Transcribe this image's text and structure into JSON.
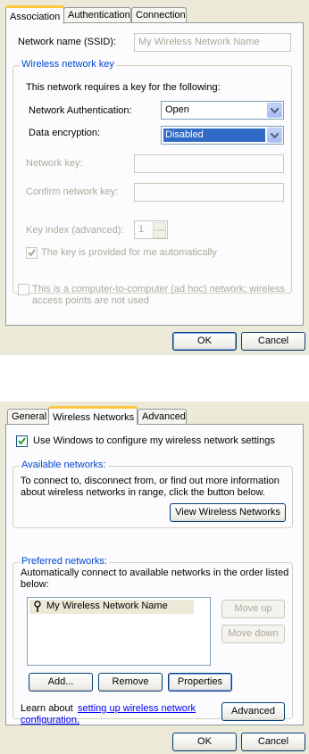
{
  "dialog1": {
    "tabs": [
      "Association",
      "Authentication",
      "Connection"
    ],
    "ssid_label": "Network name (SSID):",
    "ssid_placeholder": "My Wireless Network Name",
    "group_title": "Wireless network key",
    "requires_key_text": "This network requires a key for the following:",
    "auth_label": "Network Authentication:",
    "auth_value": "Open",
    "encryption_label": "Data encryption:",
    "encryption_value": "Disabled",
    "network_key_label": "Network key:",
    "confirm_key_label": "Confirm network key:",
    "key_index_label": "Key index (advanced):",
    "key_index_value": "1",
    "auto_key_label": "The key is provided for me automatically",
    "adhoc_line1": "This is a computer-to-computer (ad hoc) network; wireless",
    "adhoc_line2": "access points are not used",
    "ok": "OK",
    "cancel": "Cancel"
  },
  "dialog2": {
    "tabs": [
      "General",
      "Wireless Networks",
      "Advanced"
    ],
    "use_windows_label": "Use Windows to configure my wireless network settings",
    "available_title": "Available networks:",
    "available_line1": "To connect to, disconnect from, or find out more information",
    "available_line2": "about wireless networks in range, click the button below.",
    "view_button": "View Wireless Networks",
    "preferred_title": "Preferred networks:",
    "preferred_line1": "Automatically connect to available networks in the order listed",
    "preferred_line2": "below:",
    "networks": [
      "My Wireless Network Name"
    ],
    "move_up": "Move up",
    "move_down": "Move down",
    "add": "Add...",
    "remove": "Remove",
    "properties": "Properties",
    "learn_text": "Learn about",
    "learn_link_line1": "setting up wireless network",
    "learn_link_line2": "configuration.",
    "advanced_button": "Advanced",
    "ok": "OK",
    "cancel": "Cancel"
  }
}
